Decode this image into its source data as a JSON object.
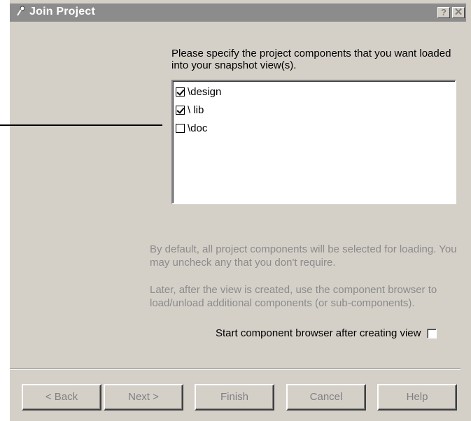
{
  "window": {
    "title": "Join Project",
    "help_glyph": "?",
    "close_glyph": "✕"
  },
  "prompt": "Please specify the project components that you want loaded into your snapshot view(s).",
  "components": [
    {
      "label": "\\design",
      "checked": true
    },
    {
      "label": "\\ lib",
      "checked": true
    },
    {
      "label": "\\doc",
      "checked": false
    }
  ],
  "info": {
    "line1": "By default, all project components will be selected for loading. You may uncheck any that you don't require.",
    "line2": "Later, after the view is created, use the component browser to load/unload additional components (or sub-components)."
  },
  "start_browser": {
    "label": "Start component browser after creating view",
    "checked": false
  },
  "buttons": {
    "back": "< Back",
    "next": "Next >",
    "finish": "Finish",
    "cancel": "Cancel",
    "help": "Help"
  },
  "icons": {
    "title": "wizard-pin-icon"
  },
  "colors": {
    "titlebar": "#8c8c8c",
    "dialog_bg": "#d4d0c8",
    "disabled_text": "#8b8b8b"
  }
}
